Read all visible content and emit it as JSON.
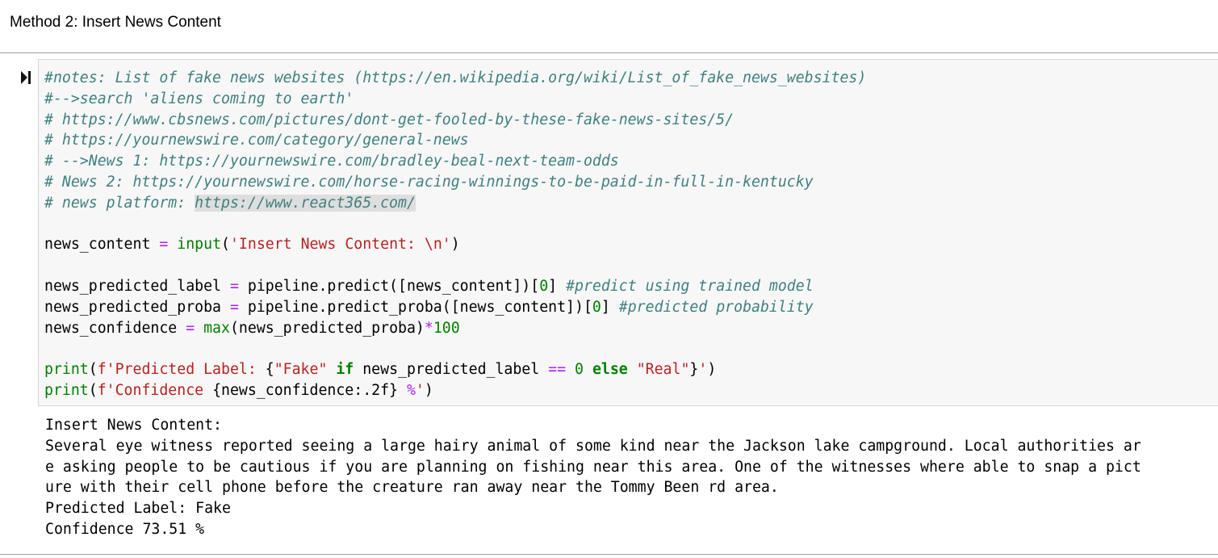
{
  "markdown": {
    "text": "Method 2: Insert News Content"
  },
  "cell": {
    "comments": [
      "#notes: List of fake news websites (https://en.wikipedia.org/wiki/List_of_fake_news_websites)",
      "#-->search 'aliens coming to earth'",
      "# https://www.cbsnews.com/pictures/dont-get-fooled-by-these-fake-news-sites/5/",
      "# https://yournewswire.com/category/general-news",
      "# -->News 1: https://yournewswire.com/bradley-beal-next-team-odds",
      "# News 2: https://yournewswire.com/horse-racing-winnings-to-be-paid-in-full-in-kentucky"
    ],
    "comment7_prefix": "# news platform: ",
    "comment7_url": "https://www.react365.com/",
    "line9": {
      "var": "news_content ",
      "eq": "=",
      "sp": " ",
      "fn": "input",
      "open": "(",
      "str": "'Insert News Content: \\n'",
      "close": ")"
    },
    "line11": {
      "code": "news_predicted_label ",
      "eq": "=",
      "code2": " pipeline.predict([news_content])[",
      "num": "0",
      "code3": "] ",
      "comment": "#predict using trained model"
    },
    "line12": {
      "code": "news_predicted_proba ",
      "eq": "=",
      "code2": " pipeline.predict_proba([news_content])[",
      "num": "0",
      "code3": "] ",
      "comment": "#predicted probability"
    },
    "line13": {
      "code": "news_confidence ",
      "eq": "=",
      "sp": " ",
      "fn": "max",
      "code2": "(news_predicted_proba)",
      "op": "*",
      "num": "100"
    },
    "line15": {
      "fn": "print",
      "open": "(",
      "str1": "f'Predicted Label: ",
      "brace1": "{",
      "str2": "\"Fake\"",
      "sp1": " ",
      "kw1": "if",
      "code": " news_predicted_label ",
      "eq": "==",
      "sp2": " ",
      "num": "0",
      "sp3": " ",
      "kw2": "else",
      "sp4": " ",
      "str3": "\"Real\"",
      "brace2": "}",
      "str4": "'",
      "close": ")"
    },
    "line16": {
      "fn": "print",
      "open": "(",
      "str1": "f'Confidence ",
      "code": "{news_confidence:.2f}",
      "sp": " ",
      "pct": "%",
      "str2": "'",
      "close": ")"
    }
  },
  "output": {
    "lines": [
      "Insert News Content:",
      "Several eye witness reported seeing a large hairy animal of some kind near the Jackson lake campground. Local authorities ar",
      "e asking people to be cautious if you are planning on fishing near this area. One of the witnesses where able to snap a pict",
      "ure with their cell phone before the creature ran away near the Tommy Been rd area.",
      "Predicted Label: Fake",
      "Confidence 73.51 %"
    ]
  },
  "icons": {
    "run": "run-cell-icon"
  },
  "colors": {
    "comment": "#408080",
    "keyword": "#008000",
    "string": "#ba2121",
    "operator": "#aa22ff",
    "code_bg": "#f7f7f7",
    "selection": "#dedede"
  }
}
